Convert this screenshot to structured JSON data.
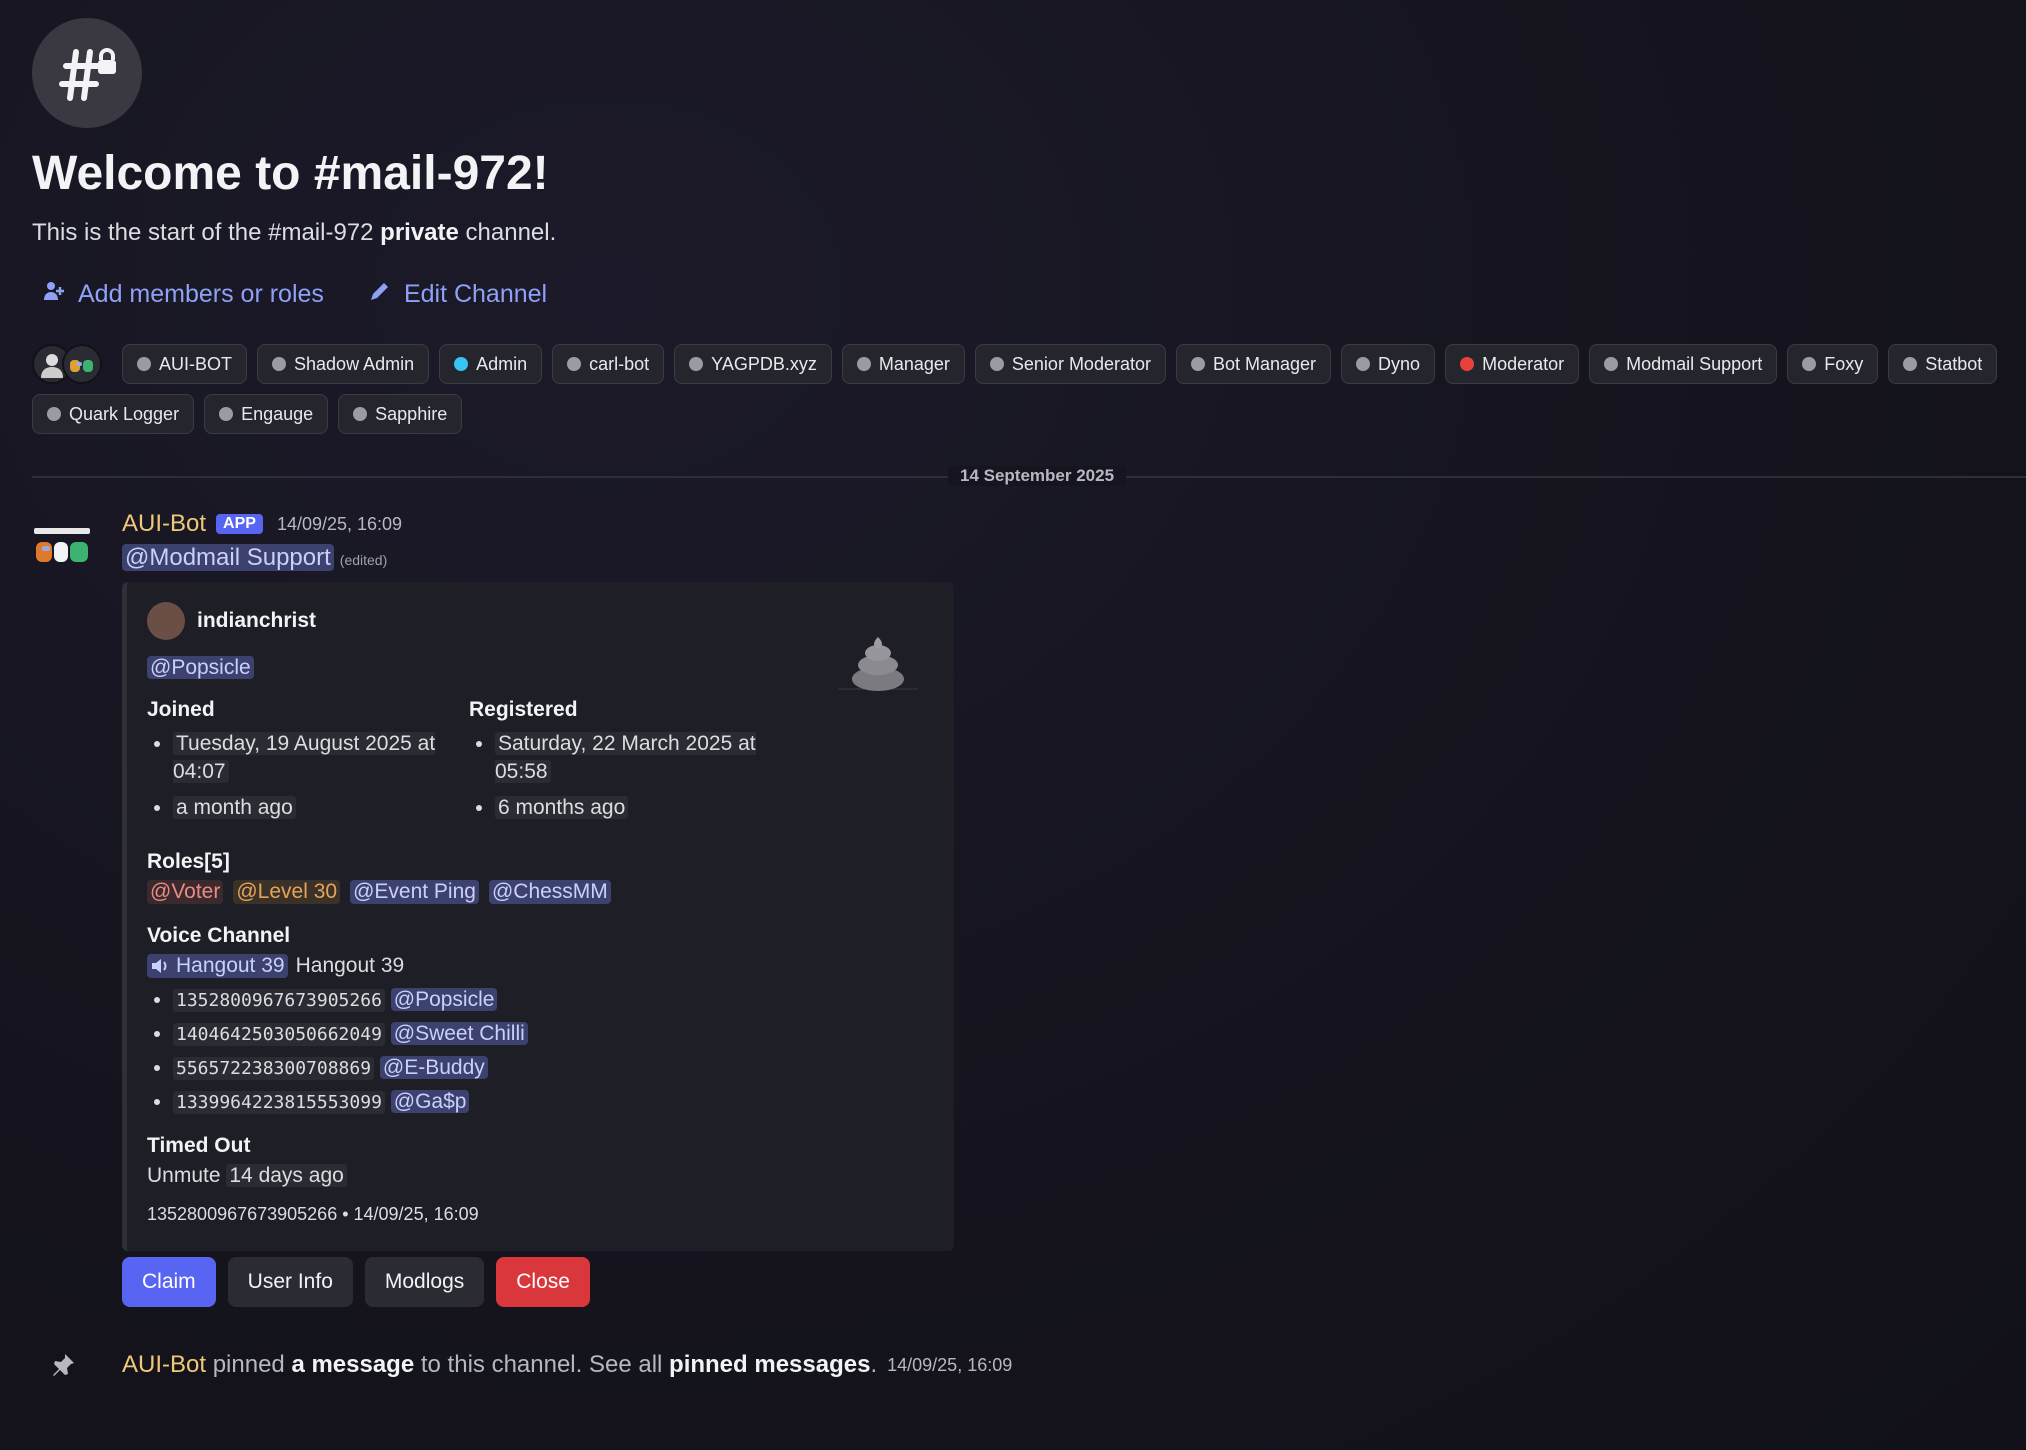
{
  "welcome": {
    "title": "Welcome to #mail-972!",
    "subtitle_pre": "This is the start of the #mail-972 ",
    "subtitle_bold": "private",
    "subtitle_post": " channel."
  },
  "actions": {
    "add": "Add members or roles",
    "edit": "Edit Channel"
  },
  "roles": [
    "AUI-BOT",
    "Shadow Admin",
    "Admin",
    "carl-bot",
    "YAGPDB.xyz",
    "Manager",
    "Senior Moderator",
    "Bot Manager",
    "Dyno",
    "Moderator",
    "Modmail Support",
    "Foxy",
    "Statbot",
    "Quark Logger",
    "Engauge",
    "Sapphire"
  ],
  "role_colors": {
    "Admin": "#38c4f0",
    "Moderator": "#e8413c",
    "default": "#9a9ba3"
  },
  "date_divider": "14 September 2025",
  "message": {
    "author": "AUI-Bot",
    "app_tag": "APP",
    "timestamp": "14/09/25, 16:09",
    "mention": "@Modmail Support",
    "edited": "(edited)",
    "embed": {
      "author": "indianchrist",
      "mention": "@Popsicle",
      "joined_label": "Joined",
      "joined_1": "Tuesday, 19 August 2025 at 04:07",
      "joined_2": "a month ago",
      "registered_label": "Registered",
      "registered_1": "Saturday, 22 March 2025 at 05:58",
      "registered_2": "6 months ago",
      "roles_label": "Roles[5]",
      "roles": [
        "@Voter",
        "@Level 30",
        "@Event Ping",
        "@ChessMM"
      ],
      "voice_label": "Voice Channel",
      "voice_channel": "Hangout 39",
      "voice_text": "Hangout 39",
      "members": [
        {
          "id": "1352800967673905266",
          "name": "@Popsicle"
        },
        {
          "id": "1404642503050662049",
          "name": "@Sweet Chilli"
        },
        {
          "id": "556572238300708869",
          "name": "@E-Buddy"
        },
        {
          "id": "1339964223815553099",
          "name": "@Ga$p"
        }
      ],
      "timed_label": "Timed Out",
      "unmute_pre": "Unmute",
      "unmute_time": "14 days ago",
      "footer": "1352800967673905266 • 14/09/25, 16:09"
    },
    "buttons": {
      "claim": "Claim",
      "info": "User Info",
      "logs": "Modlogs",
      "close": "Close"
    }
  },
  "system": {
    "author": "AUI-Bot",
    "t1": " pinned ",
    "link1": "a message",
    "t2": " to this channel. See all ",
    "link2": "pinned messages",
    "t3": ".",
    "timestamp": "14/09/25, 16:09"
  }
}
